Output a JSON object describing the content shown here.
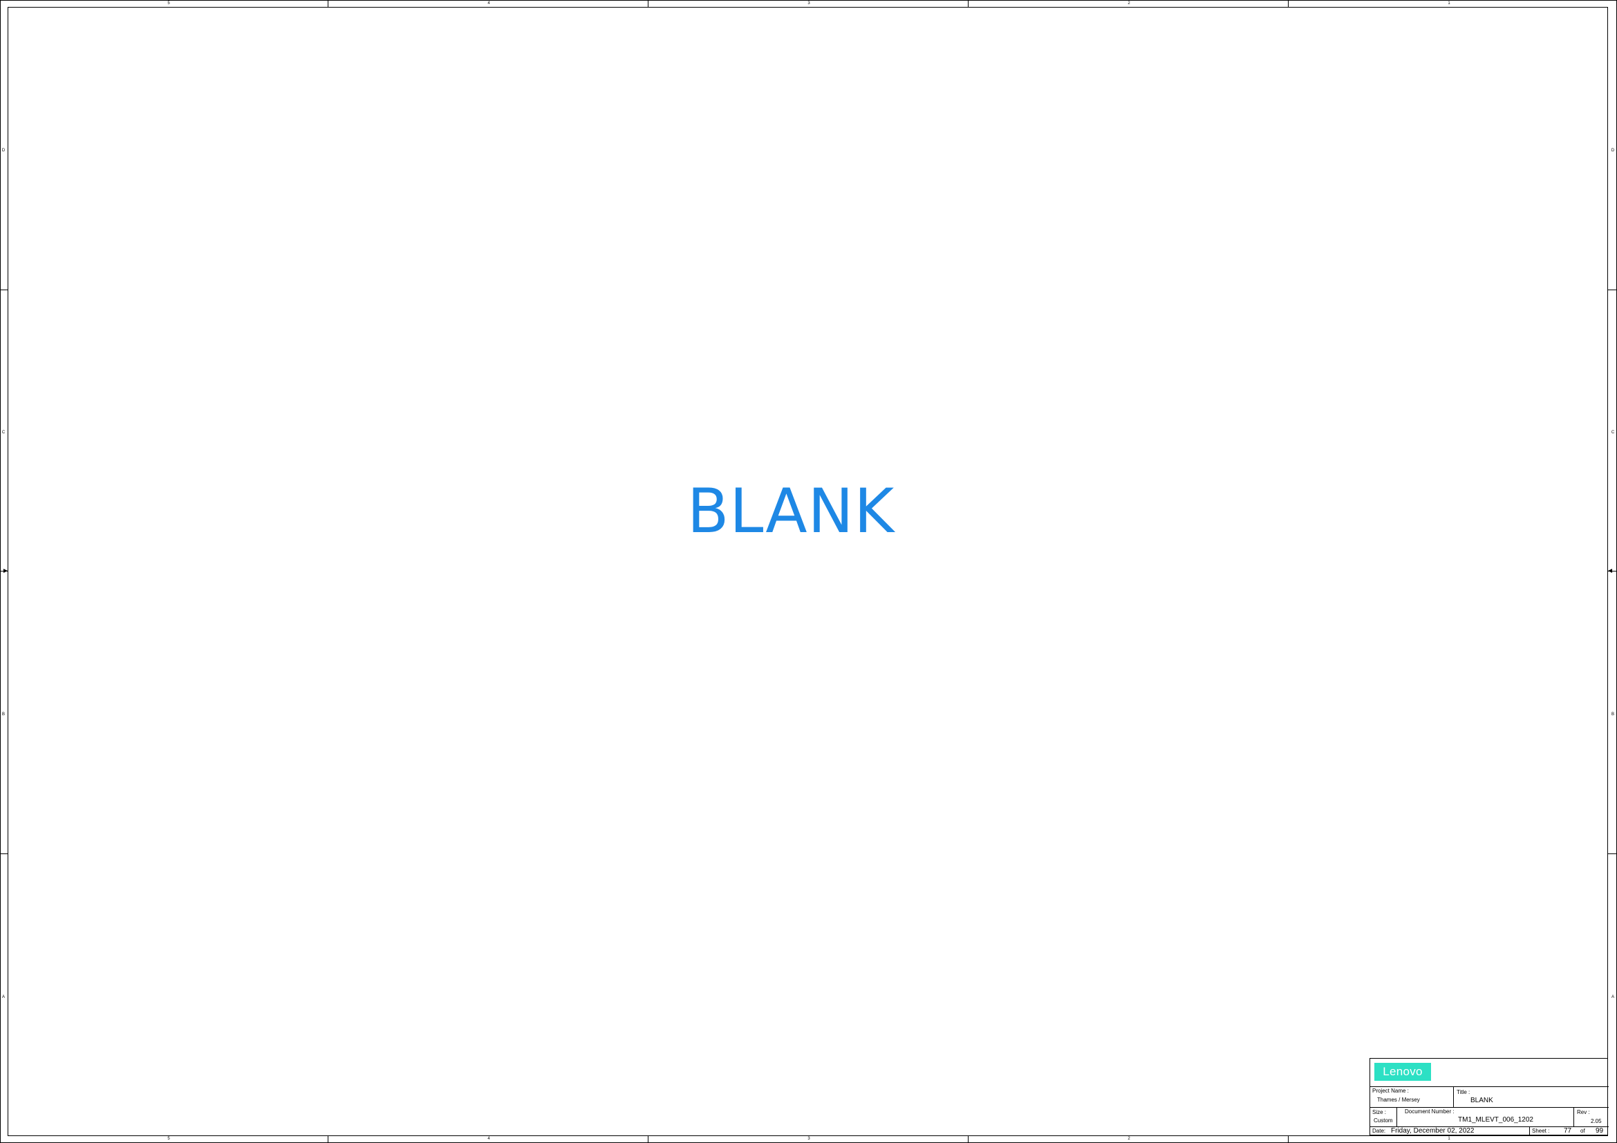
{
  "frame": {
    "top_columns": [
      "5",
      "4",
      "3",
      "2",
      "1"
    ],
    "bottom_columns": [
      "5",
      "4",
      "3",
      "2",
      "1"
    ],
    "left_rows": [
      "D",
      "C",
      "B",
      "A"
    ],
    "right_rows": [
      "D",
      "C",
      "B",
      "A"
    ]
  },
  "page": {
    "placeholder_text": "BLANK",
    "placeholder_color": "#1e88e5"
  },
  "title_block": {
    "logo_text": "Lenovo",
    "logo_color": "#2ce0c4",
    "project_name_label": "Project Name :",
    "project_name": "Thames / Mersey",
    "title_label": "Title :",
    "title": "BLANK",
    "size_label": "Size :",
    "size": "Custom",
    "document_number_label": "Document Number :",
    "document_number": "TM1_MLEVT_006_1202",
    "rev_label": "Rev :",
    "rev": "2.05",
    "date_label": "Date:",
    "date": "Friday, December 02, 2022",
    "sheet_label": "Sheet :",
    "sheet": "77",
    "of_label": "of",
    "total_sheets": "99"
  }
}
